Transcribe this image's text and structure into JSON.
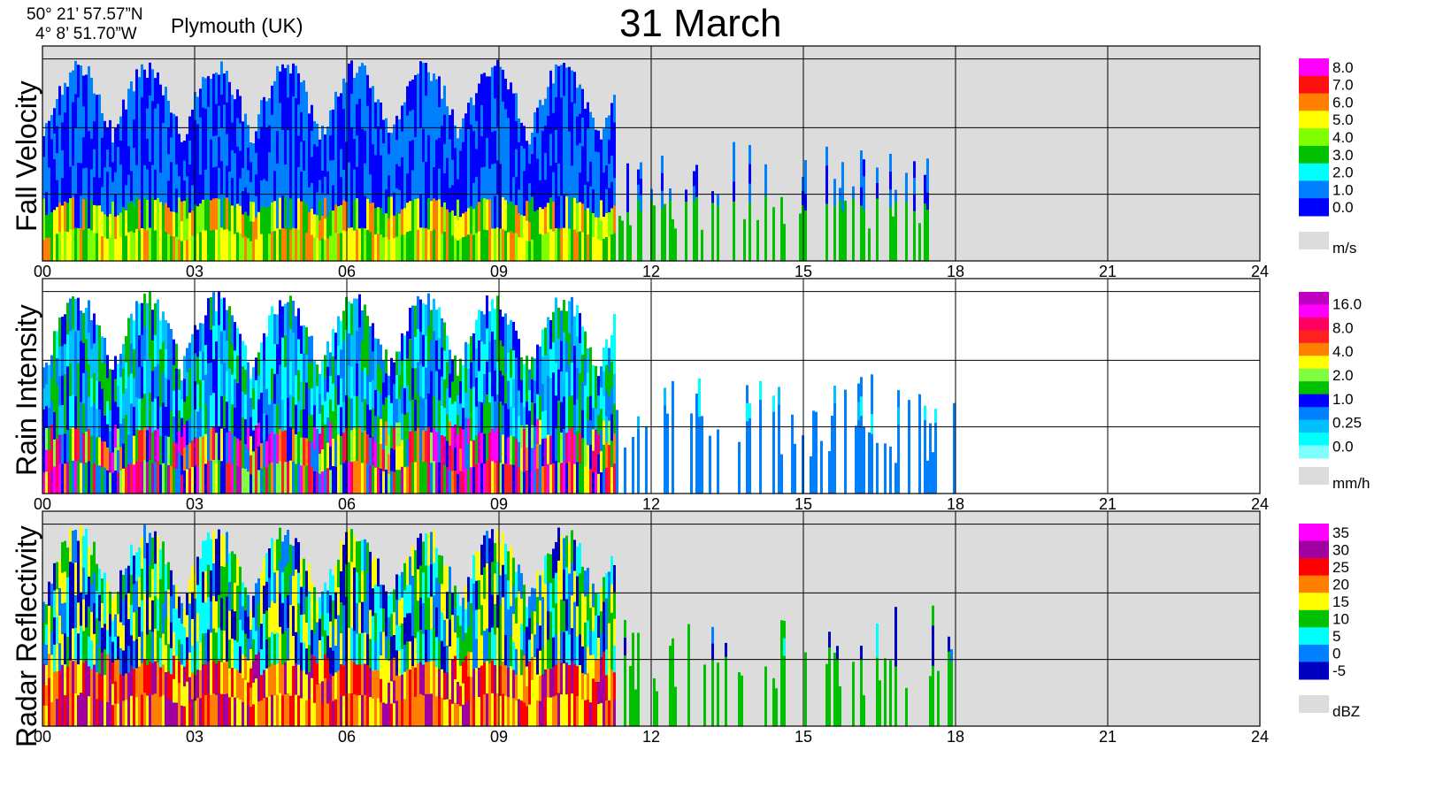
{
  "header": {
    "lat": "50° 21’ 57.57”N",
    "lon": "4°  8’ 51.70”W",
    "station": "Plymouth (UK)",
    "title": "31 March"
  },
  "colors": {
    "grey_fill": "#dcdcdc",
    "grid": "#000000"
  },
  "chart_data": [
    {
      "type": "heatmap",
      "ylabel": "Fall Velocity",
      "x_label": "",
      "x_ticks": [
        "00",
        "03",
        "06",
        "09",
        "12",
        "15",
        "18",
        "21",
        "24"
      ],
      "xlim": [
        0,
        24
      ],
      "background": "grey",
      "colorbar": {
        "unit": "m/s",
        "labels": [
          "8.0",
          "7.0",
          "6.0",
          "5.0",
          "4.0",
          "3.0",
          "2.0",
          "1.0",
          "0.0"
        ],
        "colors": [
          "#ff00ff",
          "#ff1010",
          "#ff8000",
          "#ffff00",
          "#80ff00",
          "#00c000",
          "#00ffff",
          "#0080ff",
          "#0000ff"
        ]
      },
      "activity": [
        {
          "start": 0.0,
          "end": 11.5,
          "level": "high"
        },
        {
          "start": 11.5,
          "end": 18.0,
          "level": "sparse"
        }
      ]
    },
    {
      "type": "heatmap",
      "ylabel": "Rain Intensity",
      "x_label": "",
      "x_ticks": [
        "00",
        "03",
        "06",
        "09",
        "12",
        "15",
        "18",
        "21",
        "24"
      ],
      "xlim": [
        0,
        24
      ],
      "background": "white",
      "colorbar": {
        "unit": "mm/h",
        "labels": [
          "16.0",
          "8.0",
          "4.0",
          "2.0",
          "1.0",
          "0.25",
          "0.0"
        ],
        "colors": [
          "#c000c0",
          "#ff00ff",
          "#ff0060",
          "#ff2020",
          "#ff8000",
          "#ffff00",
          "#80ff40",
          "#00c000",
          "#0000ff",
          "#0080ff",
          "#00c0ff",
          "#00ffff",
          "#80ffff"
        ]
      },
      "activity": [
        {
          "start": 0.0,
          "end": 11.5,
          "level": "high"
        },
        {
          "start": 11.5,
          "end": 18.0,
          "level": "sparse"
        }
      ]
    },
    {
      "type": "heatmap",
      "ylabel": "Radar Reflectivity",
      "x_label": "",
      "x_ticks": [
        "00",
        "03",
        "06",
        "09",
        "12",
        "15",
        "18",
        "21",
        "24"
      ],
      "xlim": [
        0,
        24
      ],
      "background": "grey",
      "colorbar": {
        "unit": "dBZ",
        "labels": [
          "35",
          "30",
          "25",
          "20",
          "15",
          "10",
          "5",
          "0",
          "-5"
        ],
        "colors": [
          "#ff00ff",
          "#a000a0",
          "#ff0000",
          "#ff8000",
          "#ffff00",
          "#00c000",
          "#00ffff",
          "#0080ff",
          "#0000c0"
        ]
      },
      "activity": [
        {
          "start": 0.0,
          "end": 11.5,
          "level": "high"
        },
        {
          "start": 11.5,
          "end": 18.0,
          "level": "sparse"
        }
      ]
    }
  ]
}
